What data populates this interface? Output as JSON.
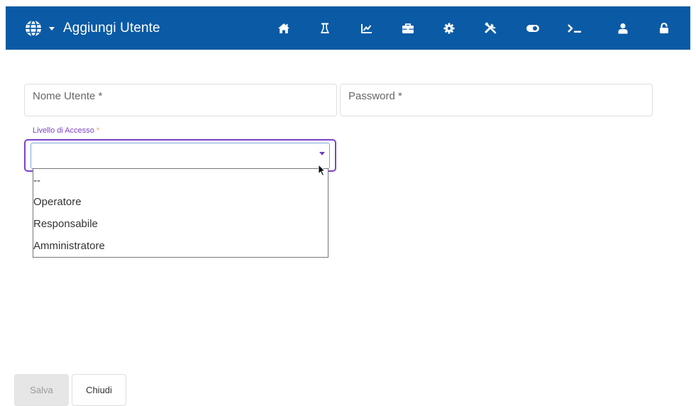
{
  "header": {
    "title": "Aggiungi Utente",
    "background": "#0a5aa5",
    "icons": [
      "globe-icon",
      "chevron-down-icon",
      "home-icon",
      "flask-icon",
      "line-chart-icon",
      "toolbox-icon",
      "gear-icon",
      "tools-icon",
      "toggle-icon",
      "terminal-icon",
      "user-icon",
      "unlock-icon"
    ]
  },
  "form": {
    "username_label": "Nome Utente *",
    "password_label": "Password *",
    "access_level": {
      "label": "Livello di Accesso",
      "required_mark": "*",
      "selected": "",
      "options": [
        "--",
        "Operatore",
        "Responsabile",
        "Amministratore"
      ],
      "accent": "#7c43c9"
    }
  },
  "actions": {
    "save_label": "Salva",
    "close_label": "Chiudi"
  }
}
